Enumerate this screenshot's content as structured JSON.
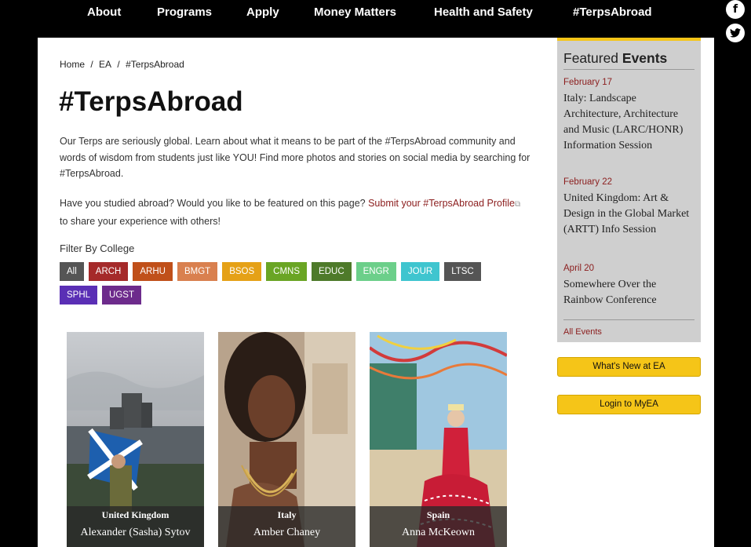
{
  "nav": {
    "items": [
      "About",
      "Programs",
      "Apply",
      "Money Matters",
      "Health and Safety",
      "#TerpsAbroad"
    ]
  },
  "social": {
    "facebook": "f",
    "twitter": "t"
  },
  "breadcrumb": [
    "Home",
    "/",
    "EA",
    "/",
    "#TerpsAbroad"
  ],
  "page": {
    "title": "#TerpsAbroad",
    "intro": "Our Terps are seriously global. Learn about what it means to be part of the #TerpsAbroad community and words of wisdom from students just like YOU! Find more photos and stories on social media by searching for #TerpsAbroad.",
    "question_prefix": "Have you studied abroad? Would you like to be featured on this page? ",
    "question_link": "Submit your #TerpsAbroad Profile",
    "question_suffix": " to share your experience with others!"
  },
  "filter": {
    "label": "Filter By College",
    "buttons": [
      {
        "label": "All",
        "color": "#555555"
      },
      {
        "label": "ARCH",
        "color": "#a52a2a"
      },
      {
        "label": "ARHU",
        "color": "#c0501a"
      },
      {
        "label": "BMGT",
        "color": "#d9804f"
      },
      {
        "label": "BSOS",
        "color": "#e5a117"
      },
      {
        "label": "CMNS",
        "color": "#6aa524"
      },
      {
        "label": "EDUC",
        "color": "#4e7a2a"
      },
      {
        "label": "ENGR",
        "color": "#6ccf8a"
      },
      {
        "label": "JOUR",
        "color": "#3fc5cf"
      },
      {
        "label": "LTSC",
        "color": "#555555"
      },
      {
        "label": "SPHL",
        "color": "#5a2fb5"
      },
      {
        "label": "UGST",
        "color": "#6d2b8c"
      }
    ]
  },
  "cards": [
    {
      "country": "United Kingdom",
      "name": "Alexander (Sasha) Sytov"
    },
    {
      "country": "Italy",
      "name": "Amber Chaney"
    },
    {
      "country": "Spain",
      "name": "Anna McKeown"
    }
  ],
  "sidebar": {
    "events_title_light": "Featured ",
    "events_title_bold": "Events",
    "events": [
      {
        "date": "February 17",
        "title": "Italy: Landscape Architecture, Architecture and Music (LARC/HONR) Information Session"
      },
      {
        "date": "February 22",
        "title": "United Kingdom: Art & Design in the Global Market (ARTT) Info Session"
      },
      {
        "date": "April 20",
        "title": "Somewhere Over the Rainbow Conference"
      }
    ],
    "all_events": "All Events",
    "whats_new": "What's New at EA",
    "login": "Login to MyEA"
  },
  "colors": {
    "accent": "#f5c518",
    "brand_red": "#8b1d1d"
  }
}
